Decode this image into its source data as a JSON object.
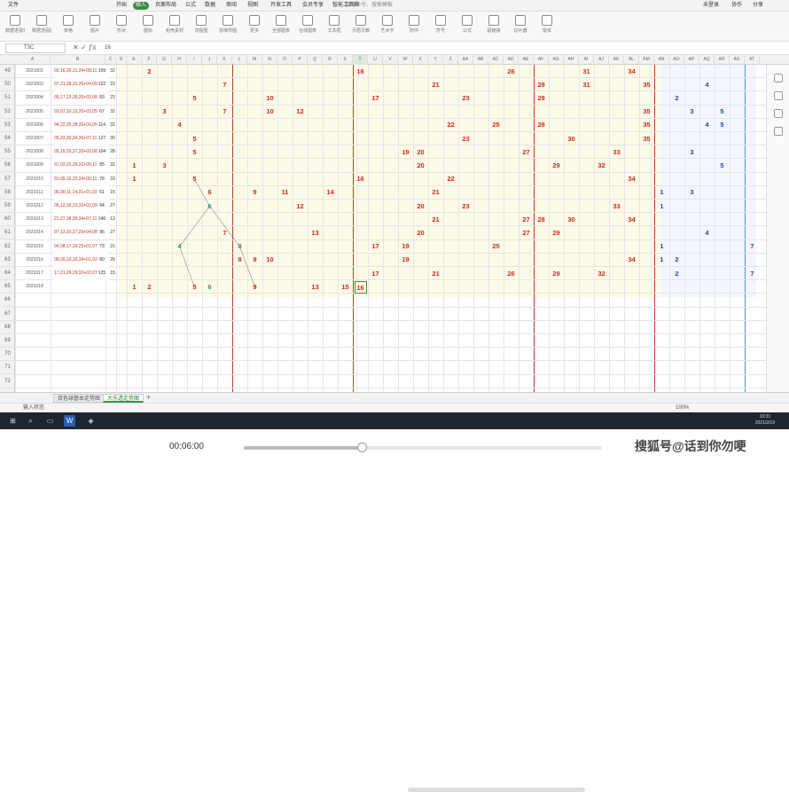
{
  "window": {
    "file_label": "文件",
    "account": "未登录",
    "collab": "协作",
    "share": "分享"
  },
  "ribbon_tabs": [
    "开始",
    "插入",
    "页面布局",
    "公式",
    "数据",
    "审阅",
    "视图",
    "开发工具",
    "会员专享",
    "智能工具箱"
  ],
  "ribbon_active": 1,
  "search_placeholder": "查找命令、搜索模板",
  "toolbar": [
    {
      "label": "数据透视表",
      "icon": "pivot-table-icon"
    },
    {
      "label": "数据透视图",
      "icon": "pivot-chart-icon"
    },
    {
      "label": "表格",
      "icon": "table-icon"
    },
    {
      "label": "图片",
      "icon": "picture-icon"
    },
    {
      "label": "形状",
      "icon": "shape-icon"
    },
    {
      "label": "图标",
      "icon": "icons-icon"
    },
    {
      "label": "稻壳素材",
      "icon": "material-icon"
    },
    {
      "label": "流程图",
      "icon": "flowchart-icon"
    },
    {
      "label": "思维导图",
      "icon": "mindmap-icon"
    },
    {
      "label": "更多",
      "icon": "more-icon"
    },
    {
      "label": "全部图表",
      "icon": "chart-icon"
    },
    {
      "label": "在线图表",
      "icon": "online-chart-icon"
    },
    {
      "label": "文本框",
      "icon": "textbox-icon"
    },
    {
      "label": "页眉页脚",
      "icon": "header-icon"
    },
    {
      "label": "艺术字",
      "icon": "wordart-icon"
    },
    {
      "label": "附件",
      "icon": "attach-icon"
    },
    {
      "label": "符号",
      "icon": "symbol-icon"
    },
    {
      "label": "公式",
      "icon": "formula-icon"
    },
    {
      "label": "超链接",
      "icon": "link-icon"
    },
    {
      "label": "切片器",
      "icon": "slicer-icon"
    },
    {
      "label": "窗体",
      "icon": "form-icon"
    }
  ],
  "formula_bar": {
    "namebox": "T3C",
    "content": "16"
  },
  "columns": [
    "A",
    "B",
    "C",
    "D",
    "E",
    "F",
    "G",
    "H",
    "I",
    "J",
    "K",
    "L",
    "M",
    "N",
    "O",
    "P",
    "Q",
    "R",
    "S",
    "T",
    "U",
    "V",
    "W",
    "X",
    "Y",
    "Z",
    "AA",
    "AB",
    "AC",
    "AD",
    "AE",
    "AF",
    "AG",
    "AH",
    "AI",
    "AJ",
    "AK",
    "AL",
    "AM",
    "AN",
    "AO",
    "AP",
    "AQ",
    "AR",
    "AS",
    "AT"
  ],
  "selected_column": "T",
  "rows": [
    {
      "num": "49",
      "date": "2021002",
      "nums": "02,16,26,31,34+08,11",
      "n1": "109",
      "n2": "32"
    },
    {
      "num": "50",
      "date": "2021003",
      "nums": "07,21,28,31,35+04,09",
      "n1": "122",
      "n2": "23"
    },
    {
      "num": "51",
      "date": "2021004",
      "nums": "05,17,23,28,35+02,08",
      "n1": "83",
      "n2": "23"
    },
    {
      "num": "52",
      "date": "2021005",
      "nums": "03,07,10,12,35+03,05",
      "n1": "67",
      "n2": "32"
    },
    {
      "num": "53",
      "date": "2021006",
      "nums": "04,22,25,28,35+04,05",
      "n1": "114",
      "n2": "31"
    },
    {
      "num": "54",
      "date": "2021007",
      "nums": "05,23,30,34,35+07,11",
      "n1": "127",
      "n2": "30"
    },
    {
      "num": "55",
      "date": "2021008",
      "nums": "05,19,20,27,33+03,08",
      "n1": "104",
      "n2": "28"
    },
    {
      "num": "56",
      "date": "2021009",
      "nums": "01,03,20,29,32+05,11",
      "n1": "85",
      "n2": "31"
    },
    {
      "num": "57",
      "date": "2021010",
      "nums": "01,05,16,22,34+05,11",
      "n1": "78",
      "n2": "33"
    },
    {
      "num": "58",
      "date": "2021011",
      "nums": "06,09,11,14,21+01,03",
      "n1": "61",
      "n2": "15"
    },
    {
      "num": "59",
      "date": "2021012",
      "nums": "06,12,20,23,33+01,09",
      "n1": "94",
      "n2": "27"
    },
    {
      "num": "60",
      "date": "2021013",
      "nums": "21,27,28,30,34+07,11",
      "n1": "140",
      "n2": "13"
    },
    {
      "num": "61",
      "date": "2021014",
      "nums": "07,13,20,27,29+04,08",
      "n1": "96",
      "n2": "27"
    },
    {
      "num": "62",
      "date": "2021015",
      "nums": "04,08,17,19,25+01,07",
      "n1": "73",
      "n2": "21"
    },
    {
      "num": "63",
      "date": "2021016",
      "nums": "08,09,10,19,34+01,02",
      "n1": "80",
      "n2": "26"
    },
    {
      "num": "64",
      "date": "2021017",
      "nums": "17,21,26,29,32+02,07",
      "n1": "125",
      "n2": "15"
    },
    {
      "num": "65",
      "date": "2021018",
      "nums": "",
      "n1": "",
      "n2": ""
    },
    {
      "num": "66",
      "date": "",
      "nums": "",
      "n1": "",
      "n2": ""
    },
    {
      "num": "67",
      "date": "",
      "nums": "",
      "n1": "",
      "n2": ""
    },
    {
      "num": "68",
      "date": "",
      "nums": "",
      "n1": "",
      "n2": ""
    },
    {
      "num": "69",
      "date": "",
      "nums": "",
      "n1": "",
      "n2": ""
    },
    {
      "num": "70",
      "date": "",
      "nums": "",
      "n1": "",
      "n2": ""
    },
    {
      "num": "71",
      "date": "",
      "nums": "",
      "n1": "",
      "n2": ""
    },
    {
      "num": "72",
      "date": "",
      "nums": "",
      "n1": "",
      "n2": ""
    }
  ],
  "marks": [
    {
      "r": 0,
      "v": "2",
      "c": "red"
    },
    {
      "r": 0,
      "v": "16",
      "c": "red"
    },
    {
      "r": 0,
      "v": "26",
      "c": "red"
    },
    {
      "r": 0,
      "v": "31",
      "c": "red"
    },
    {
      "r": 0,
      "v": "34",
      "c": "red"
    },
    {
      "r": 1,
      "v": "7",
      "c": "red"
    },
    {
      "r": 1,
      "v": "21",
      "c": "red"
    },
    {
      "r": 1,
      "v": "28",
      "c": "red"
    },
    {
      "r": 1,
      "v": "31",
      "c": "red"
    },
    {
      "r": 1,
      "v": "35",
      "c": "red"
    },
    {
      "r": 1,
      "v": "4",
      "c": "blue",
      "b": true
    },
    {
      "r": 2,
      "v": "5",
      "c": "red"
    },
    {
      "r": 2,
      "v": "10",
      "c": "red"
    },
    {
      "r": 2,
      "v": "17",
      "c": "red"
    },
    {
      "r": 2,
      "v": "23",
      "c": "red"
    },
    {
      "r": 2,
      "v": "28",
      "c": "red"
    },
    {
      "r": 2,
      "v": "2",
      "c": "blue",
      "b": true
    },
    {
      "r": 3,
      "v": "3",
      "c": "red"
    },
    {
      "r": 3,
      "v": "7",
      "c": "red"
    },
    {
      "r": 3,
      "v": "10",
      "c": "red"
    },
    {
      "r": 3,
      "v": "12",
      "c": "red"
    },
    {
      "r": 3,
      "v": "35",
      "c": "red"
    },
    {
      "r": 3,
      "v": "3",
      "c": "blue",
      "b": true
    },
    {
      "r": 3,
      "v": "5",
      "c": "blue",
      "b": true
    },
    {
      "r": 4,
      "v": "4",
      "c": "red"
    },
    {
      "r": 4,
      "v": "22",
      "c": "red"
    },
    {
      "r": 4,
      "v": "25",
      "c": "red"
    },
    {
      "r": 4,
      "v": "28",
      "c": "red"
    },
    {
      "r": 4,
      "v": "35",
      "c": "red"
    },
    {
      "r": 4,
      "v": "4",
      "c": "blue",
      "b": true
    },
    {
      "r": 4,
      "v": "5",
      "c": "blue",
      "b": true
    },
    {
      "r": 5,
      "v": "5",
      "c": "red"
    },
    {
      "r": 5,
      "v": "23",
      "c": "red"
    },
    {
      "r": 5,
      "v": "30",
      "c": "red"
    },
    {
      "r": 5,
      "v": "35",
      "c": "red"
    },
    {
      "r": 6,
      "v": "5",
      "c": "red"
    },
    {
      "r": 6,
      "v": "19",
      "c": "red"
    },
    {
      "r": 6,
      "v": "20",
      "c": "red"
    },
    {
      "r": 6,
      "v": "27",
      "c": "red"
    },
    {
      "r": 6,
      "v": "33",
      "c": "red"
    },
    {
      "r": 6,
      "v": "3",
      "c": "blue",
      "b": true
    },
    {
      "r": 7,
      "v": "1",
      "c": "red"
    },
    {
      "r": 7,
      "v": "3",
      "c": "red"
    },
    {
      "r": 7,
      "v": "20",
      "c": "red"
    },
    {
      "r": 7,
      "v": "29",
      "c": "red"
    },
    {
      "r": 7,
      "v": "32",
      "c": "red"
    },
    {
      "r": 7,
      "v": "5",
      "c": "blue",
      "b": true
    },
    {
      "r": 8,
      "v": "1",
      "c": "red"
    },
    {
      "r": 8,
      "v": "5",
      "c": "red"
    },
    {
      "r": 8,
      "v": "16",
      "c": "red"
    },
    {
      "r": 8,
      "v": "22",
      "c": "red"
    },
    {
      "r": 8,
      "v": "34",
      "c": "red"
    },
    {
      "r": 9,
      "v": "6",
      "c": "red"
    },
    {
      "r": 9,
      "v": "9",
      "c": "red"
    },
    {
      "r": 9,
      "v": "11",
      "c": "red"
    },
    {
      "r": 9,
      "v": "14",
      "c": "red"
    },
    {
      "r": 9,
      "v": "21",
      "c": "red"
    },
    {
      "r": 9,
      "v": "1",
      "c": "blue",
      "b": true
    },
    {
      "r": 9,
      "v": "3",
      "c": "blue",
      "b": true
    },
    {
      "r": 10,
      "v": "6",
      "c": "green"
    },
    {
      "r": 10,
      "v": "12",
      "c": "red"
    },
    {
      "r": 10,
      "v": "20",
      "c": "red"
    },
    {
      "r": 10,
      "v": "23",
      "c": "red"
    },
    {
      "r": 10,
      "v": "33",
      "c": "red"
    },
    {
      "r": 10,
      "v": "1",
      "c": "blue",
      "b": true
    },
    {
      "r": 11,
      "v": "21",
      "c": "red"
    },
    {
      "r": 11,
      "v": "27",
      "c": "red"
    },
    {
      "r": 11,
      "v": "28",
      "c": "red"
    },
    {
      "r": 11,
      "v": "30",
      "c": "red"
    },
    {
      "r": 11,
      "v": "34",
      "c": "red"
    },
    {
      "r": 12,
      "v": "7",
      "c": "red"
    },
    {
      "r": 12,
      "v": "13",
      "c": "red"
    },
    {
      "r": 12,
      "v": "20",
      "c": "red"
    },
    {
      "r": 12,
      "v": "27",
      "c": "red"
    },
    {
      "r": 12,
      "v": "29",
      "c": "red"
    },
    {
      "r": 12,
      "v": "4",
      "c": "blue",
      "b": true
    },
    {
      "r": 13,
      "v": "4",
      "c": "green"
    },
    {
      "r": 13,
      "v": "8",
      "c": "green"
    },
    {
      "r": 13,
      "v": "17",
      "c": "red"
    },
    {
      "r": 13,
      "v": "19",
      "c": "red"
    },
    {
      "r": 13,
      "v": "25",
      "c": "red"
    },
    {
      "r": 13,
      "v": "1",
      "c": "blue",
      "b": true
    },
    {
      "r": 13,
      "v": "7",
      "c": "blue",
      "b": true
    },
    {
      "r": 14,
      "v": "8",
      "c": "red"
    },
    {
      "r": 14,
      "v": "9",
      "c": "red"
    },
    {
      "r": 14,
      "v": "10",
      "c": "red"
    },
    {
      "r": 14,
      "v": "19",
      "c": "red"
    },
    {
      "r": 14,
      "v": "34",
      "c": "red"
    },
    {
      "r": 14,
      "v": "1",
      "c": "blue",
      "b": true
    },
    {
      "r": 14,
      "v": "2",
      "c": "blue",
      "b": true
    },
    {
      "r": 15,
      "v": "17",
      "c": "red"
    },
    {
      "r": 15,
      "v": "21",
      "c": "red"
    },
    {
      "r": 15,
      "v": "26",
      "c": "red"
    },
    {
      "r": 15,
      "v": "29",
      "c": "red"
    },
    {
      "r": 15,
      "v": "32",
      "c": "red"
    },
    {
      "r": 15,
      "v": "2",
      "c": "blue",
      "b": true
    },
    {
      "r": 15,
      "v": "7",
      "c": "blue",
      "b": true
    },
    {
      "r": 16,
      "v": "1",
      "c": "red"
    },
    {
      "r": 16,
      "v": "2",
      "c": "red"
    },
    {
      "r": 16,
      "v": "5",
      "c": "red"
    },
    {
      "r": 16,
      "v": "6",
      "c": "green"
    },
    {
      "r": 16,
      "v": "9",
      "c": "red"
    },
    {
      "r": 16,
      "v": "13",
      "c": "red"
    },
    {
      "r": 16,
      "v": "15",
      "c": "red"
    },
    {
      "r": 16,
      "v": "16",
      "c": "red",
      "sel": true
    }
  ],
  "sheets": [
    "双色球基本走势图",
    "大乐透走势图"
  ],
  "active_sheet": 1,
  "status": {
    "left": "输入状态",
    "zoom": "100%"
  },
  "clock": {
    "time": "10:31",
    "date": "2021/2/19"
  },
  "player": {
    "time": "00:06:00",
    "progress": 0.33
  },
  "watermark": "搜狐号@话到你勿哽"
}
